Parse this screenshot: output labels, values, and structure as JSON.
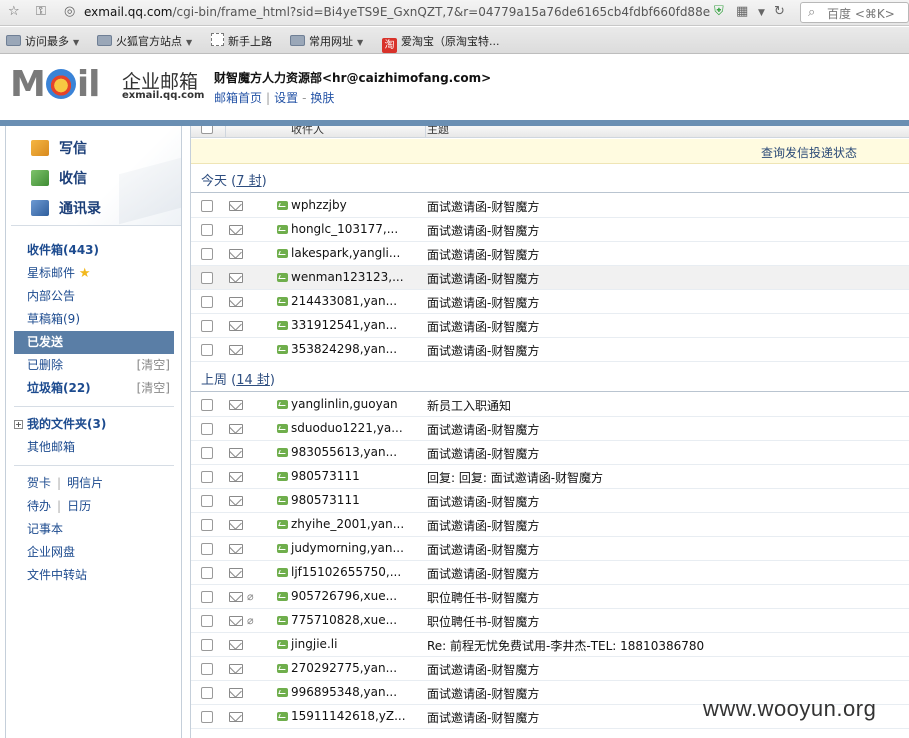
{
  "browser": {
    "url_host": "exmail.qq.com",
    "url_path": "/cgi-bin/frame_html?sid=Bi4yeTS9E_GxnQZT,7&r=04779a15a76de6165cb4fdbf660fd88e",
    "search_placeholder": "百度 <⌘K>"
  },
  "bookmarks": [
    {
      "label": "访问最多",
      "icon": "folder-icon"
    },
    {
      "label": "火狐官方站点",
      "icon": "folder-icon"
    },
    {
      "label": "新手上路",
      "icon": "dashed-box-icon"
    },
    {
      "label": "常用网址",
      "icon": "folder-icon"
    },
    {
      "label": "爱淘宝（原淘宝特...",
      "icon": "taobao-icon",
      "icon_text": "淘"
    }
  ],
  "header": {
    "logo": "MOil",
    "brand_cn": "企业邮箱",
    "brand_en": "exmail.qq.com",
    "account": "财智魔方人力资源部<hr@caizhimofang.com>",
    "links": [
      "邮箱首页",
      "设置",
      "换肤"
    ],
    "link_sep": "-"
  },
  "sidebar": {
    "quick": [
      {
        "label": "写信",
        "icon": "write-icon"
      },
      {
        "label": "收信",
        "icon": "inbox-download-icon"
      },
      {
        "label": "通讯录",
        "icon": "address-book-icon"
      }
    ],
    "folders": [
      {
        "label": "收件箱(443)",
        "bold": true
      },
      {
        "label": "星标邮件",
        "star": "★"
      },
      {
        "label": "内部公告"
      },
      {
        "label": "草稿箱(9)"
      },
      {
        "label": "已发送",
        "active": true
      },
      {
        "label": "已删除",
        "clear": "[清空]"
      },
      {
        "label": "垃圾箱(22)",
        "bold": true,
        "clear": "[清空]"
      }
    ],
    "my_folders": "我的文件夹(3)",
    "my_folders_toggle": "+",
    "other": "其他邮箱",
    "tools": [
      [
        "贺卡",
        "明信片"
      ],
      [
        "待办",
        "日历"
      ],
      [
        "记事本"
      ],
      [
        "企业网盘"
      ],
      [
        "文件中转站"
      ]
    ]
  },
  "list": {
    "col_from": "收件人",
    "col_subject": "主题",
    "notice": "查询发信投递状态",
    "groups": [
      {
        "title": "今天",
        "count": "7 封",
        "rows": [
          {
            "from": "wphzzjby",
            "subject": "面试邀请函-财智魔方"
          },
          {
            "from": "honglc_103177,...",
            "subject": "面试邀请函-财智魔方"
          },
          {
            "from": "lakespark,yangli...",
            "subject": "面试邀请函-财智魔方"
          },
          {
            "from": "wenman123123,...",
            "subject": "面试邀请函-财智魔方",
            "hl": true
          },
          {
            "from": "214433081,yan...",
            "subject": "面试邀请函-财智魔方"
          },
          {
            "from": "331912541,yan...",
            "subject": "面试邀请函-财智魔方"
          },
          {
            "from": "353824298,yan...",
            "subject": "面试邀请函-财智魔方"
          }
        ]
      },
      {
        "title": "上周",
        "count": "14 封",
        "rows": [
          {
            "from": "yanglinlin,guoyan",
            "subject": "新员工入职通知"
          },
          {
            "from": "sduoduo1221,ya...",
            "subject": "面试邀请函-财智魔方"
          },
          {
            "from": "983055613,yan...",
            "subject": "面试邀请函-财智魔方"
          },
          {
            "from": "980573111",
            "subject": "回复: 回复: 面试邀请函-财智魔方"
          },
          {
            "from": "980573111",
            "subject": "面试邀请函-财智魔方"
          },
          {
            "from": "zhyihe_2001,yan...",
            "subject": "面试邀请函-财智魔方"
          },
          {
            "from": "judymorning,yan...",
            "subject": "面试邀请函-财智魔方"
          },
          {
            "from": "ljf15102655750,...",
            "subject": "面试邀请函-财智魔方"
          },
          {
            "from": "905726796,xue...",
            "subject": "职位聘任书-财智魔方",
            "attach": true
          },
          {
            "from": "775710828,xue...",
            "subject": "职位聘任书-财智魔方",
            "attach": true
          },
          {
            "from": "jingjie.li",
            "subject": "Re: 前程无忧免费试用-李井杰-TEL: 18810386780"
          },
          {
            "from": "270292775,yan...",
            "subject": "面试邀请函-财智魔方"
          },
          {
            "from": "996895348,yan...",
            "subject": "面试邀请函-财智魔方"
          },
          {
            "from": "15911142618,yZ...",
            "subject": "面试邀请函-财智魔方"
          }
        ]
      }
    ]
  },
  "watermark": "www.wooyun.org"
}
